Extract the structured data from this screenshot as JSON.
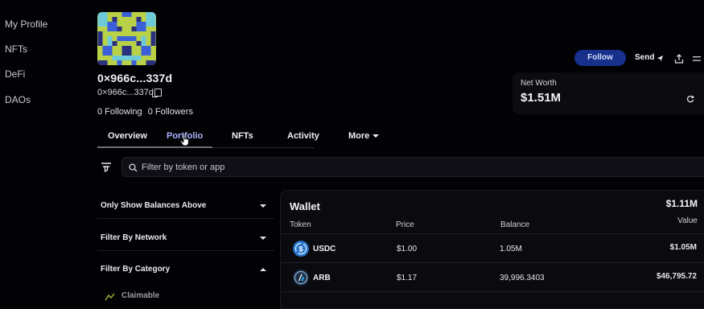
{
  "nav": {
    "items": [
      {
        "label": "My Profile"
      },
      {
        "label": "NFTs"
      },
      {
        "label": "DeFi"
      },
      {
        "label": "DAOs"
      }
    ]
  },
  "profile": {
    "title": "0×966c...337d",
    "address_short": "0×966c...337d",
    "following": "0 Following",
    "followers": "0 Followers",
    "avatar_colors": [
      "#b9d146",
      "#3a5fd8",
      "#2a2f80",
      "#6ec9d8",
      "#e2e27a"
    ]
  },
  "tabs": [
    {
      "label": "Overview"
    },
    {
      "label": "Portfolio",
      "active": true
    },
    {
      "label": "NFTs"
    },
    {
      "label": "Activity"
    },
    {
      "label": "More"
    }
  ],
  "actions": {
    "follow_label": "Follow",
    "send_label": "Send",
    "icons": [
      "send-icon",
      "share-icon",
      "more-icon"
    ]
  },
  "net_worth": {
    "label": "Net Worth",
    "value": "$1.51M"
  },
  "search": {
    "placeholder": "Filter by token or app"
  },
  "filters": [
    {
      "label": "Only Show Balances Above",
      "state": "collapsed"
    },
    {
      "label": "Filter By Network",
      "state": "collapsed"
    },
    {
      "label": "Filter By Category",
      "state": "expanded"
    }
  ],
  "category_options": [
    {
      "label": "Claimable"
    }
  ],
  "wallet": {
    "title": "Wallet",
    "total": "$1.11M",
    "columns": {
      "token": "Token",
      "price": "Price",
      "balance": "Balance",
      "value": "Value"
    },
    "rows": [
      {
        "token": "USDC",
        "price": "$1.00",
        "balance": "1.05M",
        "value": "$1.05M",
        "icon_color": "#2775ca"
      },
      {
        "token": "ARB",
        "price": "$1.17",
        "balance": "39,996.3403",
        "value": "$46,795.72",
        "icon_color": "#213147"
      }
    ]
  },
  "colors": {
    "background": "#020204",
    "accent_tab": "#a8b5ff",
    "follow_button": "#16308c"
  }
}
